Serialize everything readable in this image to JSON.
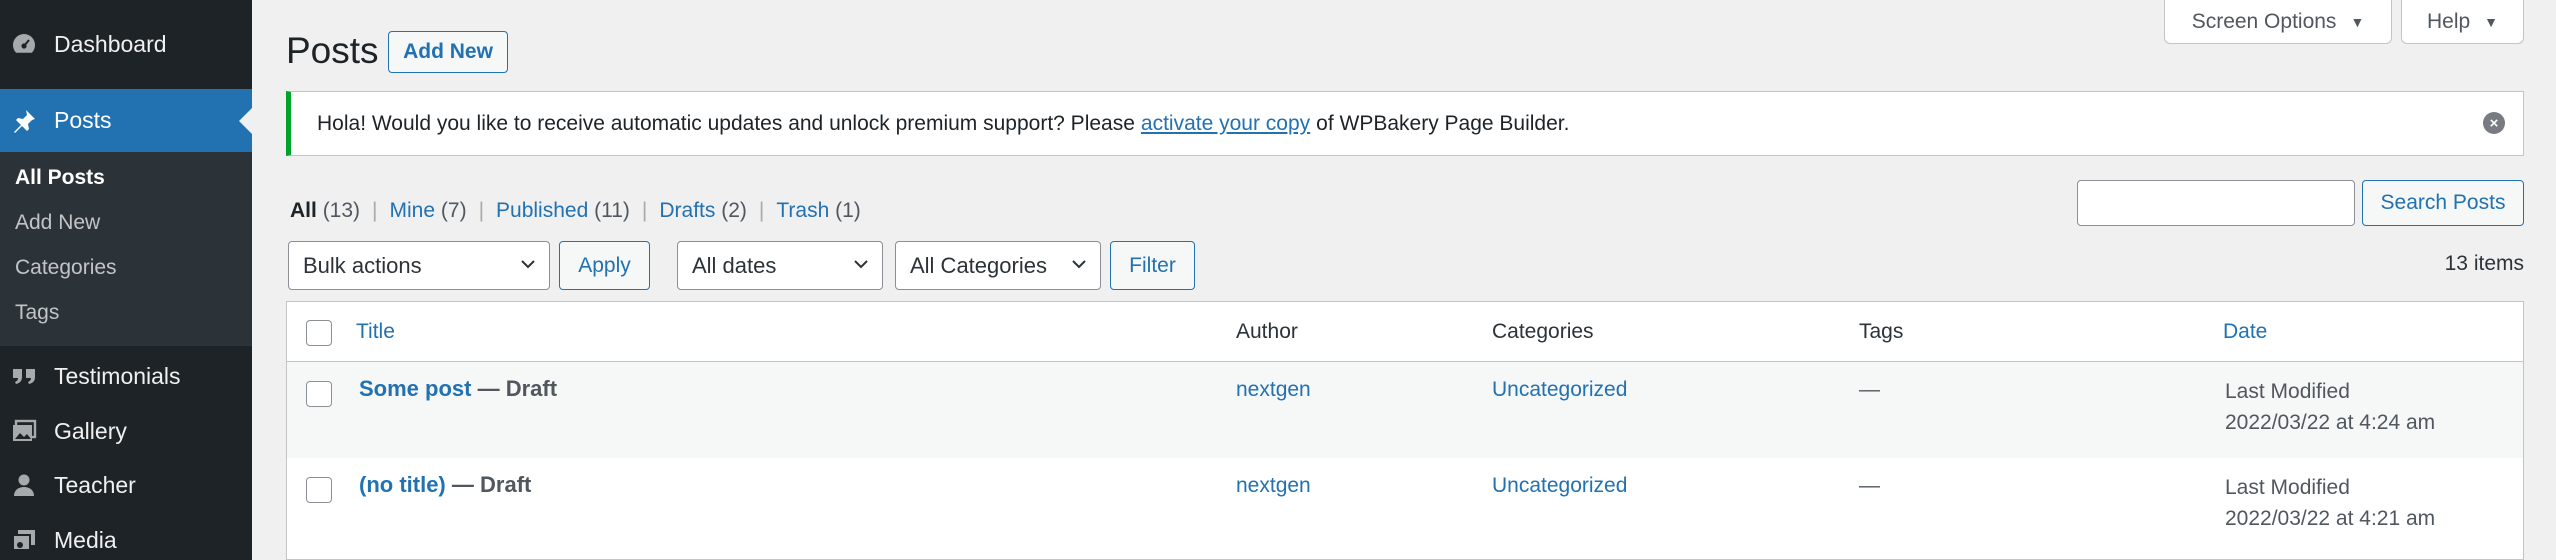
{
  "sidebar": {
    "dashboard": "Dashboard",
    "posts": "Posts",
    "submenu": [
      "All Posts",
      "Add New",
      "Categories",
      "Tags"
    ],
    "testimonials": "Testimonials",
    "gallery": "Gallery",
    "teacher": "Teacher",
    "media": "Media"
  },
  "top_tabs": {
    "screen_options": "Screen Options",
    "help": "Help"
  },
  "page_title": "Posts",
  "add_new_label": "Add New",
  "notice": {
    "before": "Hola! Would you like to receive automatic updates and unlock premium support? Please",
    "link": "activate your copy",
    "after": "of WPBakery Page Builder."
  },
  "views": [
    {
      "label": "All",
      "count": "(13)"
    },
    {
      "label": "Mine",
      "count": "(7)"
    },
    {
      "label": "Published",
      "count": "(11)"
    },
    {
      "label": "Drafts",
      "count": "(2)"
    },
    {
      "label": "Trash",
      "count": "(1)"
    }
  ],
  "search": {
    "placeholder": "",
    "button": "Search Posts"
  },
  "filters": {
    "bulk_actions": "Bulk actions",
    "apply": "Apply",
    "dates": "All dates",
    "categories": "All Categories",
    "filter": "Filter"
  },
  "items_count": "13 items",
  "table": {
    "columns": {
      "title": "Title",
      "author": "Author",
      "categories": "Categories",
      "tags": "Tags",
      "date": "Date"
    },
    "rows": [
      {
        "title": "Some post",
        "state": "— Draft",
        "author": "nextgen",
        "categories": "Uncategorized",
        "tags": "—",
        "date_label": "Last Modified",
        "date": "2022/03/22 at 4:24 am"
      },
      {
        "title": "(no title)",
        "state": "— Draft",
        "author": "nextgen",
        "categories": "Uncategorized",
        "tags": "—",
        "date_label": "Last Modified",
        "date": "2022/03/22 at 4:21 am"
      }
    ]
  }
}
